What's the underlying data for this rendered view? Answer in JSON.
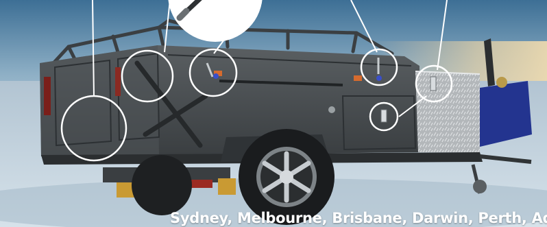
{
  "image": {
    "subject": "camper-trailer-feature-callouts",
    "caption": "Sydney, Melbourne, Brisbane, Darwin, Perth, Ad",
    "callout_count": 7
  },
  "colors": {
    "sky_top": "#3d6f95",
    "sky_bottom": "#bcd2de",
    "ground": "#c9d7e1",
    "trailer_body": "#4a4f52",
    "checker_plate": "#b9bdc0",
    "tent_blue": "#23348f",
    "callout_line": "#ffffff",
    "caption_text": "#ffffff"
  }
}
